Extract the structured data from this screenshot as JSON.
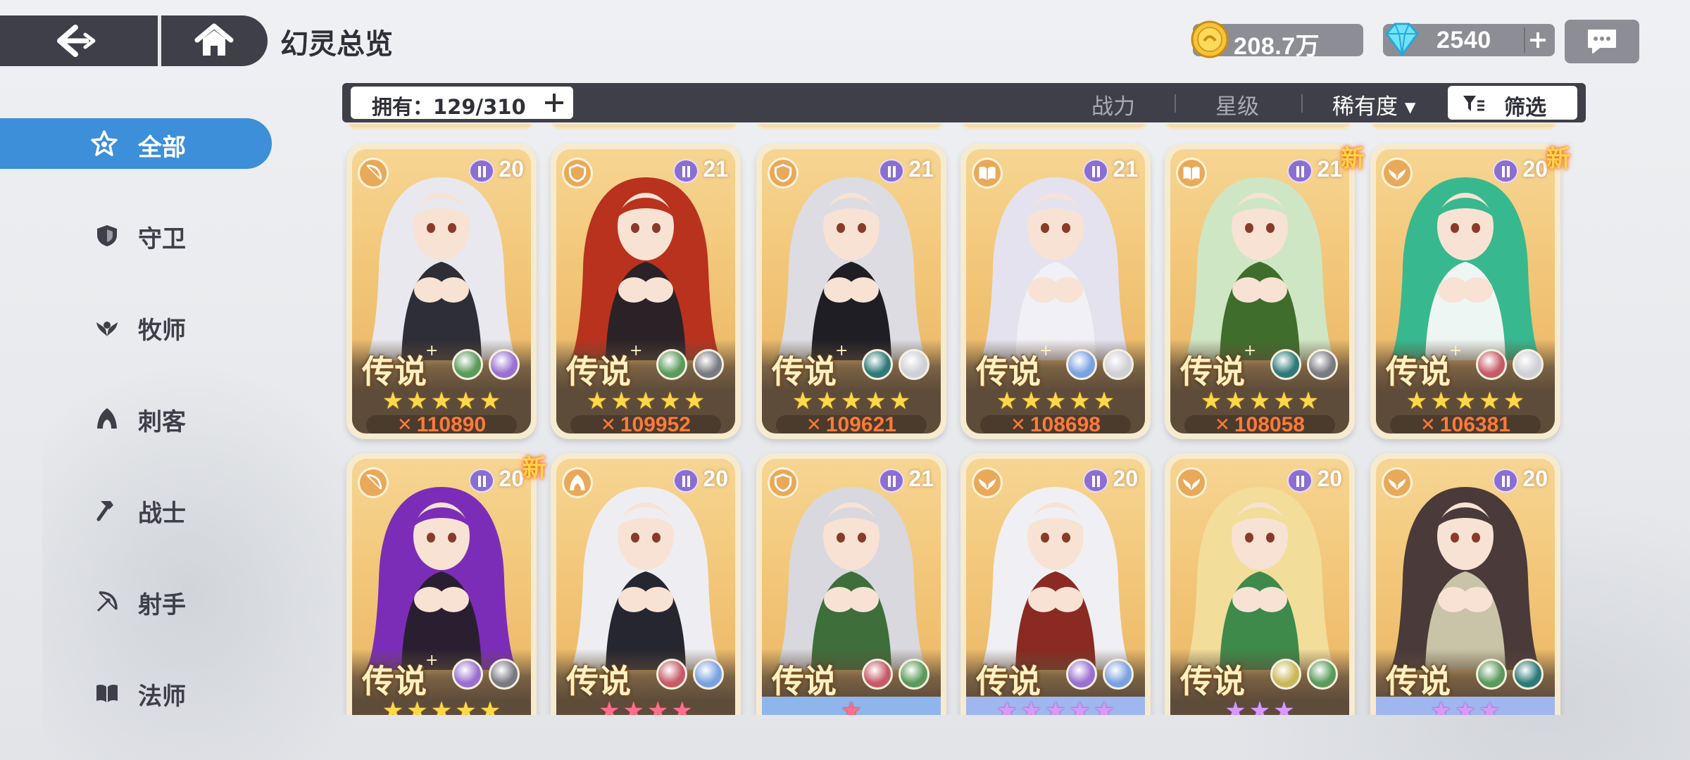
{
  "header": {
    "title": "幻灵总览",
    "gold": "208.7万",
    "gems": "2540"
  },
  "filter": {
    "owned_label": "拥有：129/310",
    "sort_power": "战力",
    "sort_star": "星级",
    "sort_rarity": "稀有度 ▾",
    "filter_label": "筛选"
  },
  "sidebar": {
    "items": [
      {
        "label": "全部",
        "icon": "all-star-icon",
        "active": true
      },
      {
        "label": "守卫",
        "icon": "shield-icon"
      },
      {
        "label": "牧师",
        "icon": "priest-wings-icon"
      },
      {
        "label": "刺客",
        "icon": "assassin-hood-icon"
      },
      {
        "label": "战士",
        "icon": "hammer-icon"
      },
      {
        "label": "射手",
        "icon": "bow-icon"
      },
      {
        "label": "法师",
        "icon": "book-icon"
      }
    ]
  },
  "cards": [
    {
      "rank": "传说",
      "plus": true,
      "level": "20",
      "new": false,
      "class": "bow-icon",
      "elements": [
        "#5a9a5a",
        "#9a6fd0"
      ],
      "stars": 5,
      "star_color": "gold",
      "power": "110890",
      "hair": "#e8e8ee",
      "accent": "#2e2e36"
    },
    {
      "rank": "传说",
      "plus": true,
      "level": "21",
      "new": false,
      "class": "shield-icon",
      "elements": [
        "#5a9a5a",
        "#7a7a82"
      ],
      "stars": 5,
      "star_color": "gold",
      "power": "109952",
      "hair": "#b8321e",
      "accent": "#2a2226"
    },
    {
      "rank": "传说",
      "plus": true,
      "level": "21",
      "new": false,
      "class": "shield-icon",
      "elements": [
        "#2e7a78",
        "#cfcfd6"
      ],
      "stars": 5,
      "star_color": "gold",
      "power": "109621",
      "hair": "#dcdce2",
      "accent": "#1e1e24"
    },
    {
      "rank": "传说",
      "plus": true,
      "level": "21",
      "new": false,
      "class": "book-icon",
      "elements": [
        "#7aa2e0",
        "#cfcfd6"
      ],
      "stars": 5,
      "star_color": "gold",
      "power": "108698",
      "hair": "#e4e2ee",
      "accent": "#f1f0f6"
    },
    {
      "rank": "传说",
      "plus": true,
      "level": "21",
      "new": true,
      "class": "book-icon",
      "elements": [
        "#2e7a78",
        "#7a7a82"
      ],
      "stars": 5,
      "star_color": "gold",
      "power": "108058",
      "hair": "#cfe6c4",
      "accent": "#3f6e2c"
    },
    {
      "rank": "传说",
      "plus": true,
      "level": "20",
      "new": true,
      "class": "priest-wings-icon",
      "elements": [
        "#c65a66",
        "#cfcfd6"
      ],
      "stars": 5,
      "star_color": "gold",
      "power": "106381",
      "hair": "#38b88e",
      "accent": "#eef6f4"
    },
    {
      "rank": "传说",
      "plus": true,
      "level": "20",
      "new": true,
      "class": "bow-icon",
      "elements": [
        "#9a6fd0",
        "#7a7a82"
      ],
      "stars": 5,
      "star_color": "gold",
      "power": "",
      "hair": "#7c2db8",
      "accent": "#2a1f30"
    },
    {
      "rank": "传说",
      "plus": false,
      "level": "20",
      "new": false,
      "class": "assassin-hood-icon",
      "elements": [
        "#c65a66",
        "#7aa2e0"
      ],
      "stars": 4,
      "star_color": "pink",
      "power": "",
      "hair": "#eeeef2",
      "accent": "#262630"
    },
    {
      "rank": "传说",
      "plus": false,
      "level": "21",
      "new": false,
      "class": "shield-icon",
      "elements": [
        "#c65a66",
        "#5a9a5a"
      ],
      "stars": 1,
      "star_color": "pink",
      "power": "",
      "hair": "#d8d8de",
      "accent": "#3e6e3a",
      "star_bg": "blue"
    },
    {
      "rank": "传说",
      "plus": false,
      "level": "20",
      "new": false,
      "class": "priest-wings-icon",
      "elements": [
        "#9a6fd0",
        "#7aa2e0"
      ],
      "stars": 5,
      "star_color": "lilac",
      "power": "",
      "hair": "#f0f0f4",
      "accent": "#8a2a22",
      "star_bg": "lav"
    },
    {
      "rank": "传说",
      "plus": false,
      "level": "20",
      "new": false,
      "class": "priest-wings-icon",
      "elements": [
        "#c9b85a",
        "#5a9a5a"
      ],
      "stars": 3,
      "star_color": "lilac",
      "power": "",
      "hair": "#f2dd9a",
      "accent": "#3e8a4a"
    },
    {
      "rank": "传说",
      "plus": false,
      "level": "20",
      "new": false,
      "class": "priest-wings-icon",
      "elements": [
        "#5a9a5a",
        "#2e7a78"
      ],
      "stars": 3,
      "star_color": "lilac",
      "power": "",
      "hair": "#4a3a3a",
      "accent": "#c9c4a8",
      "star_bg": "lav"
    }
  ]
}
